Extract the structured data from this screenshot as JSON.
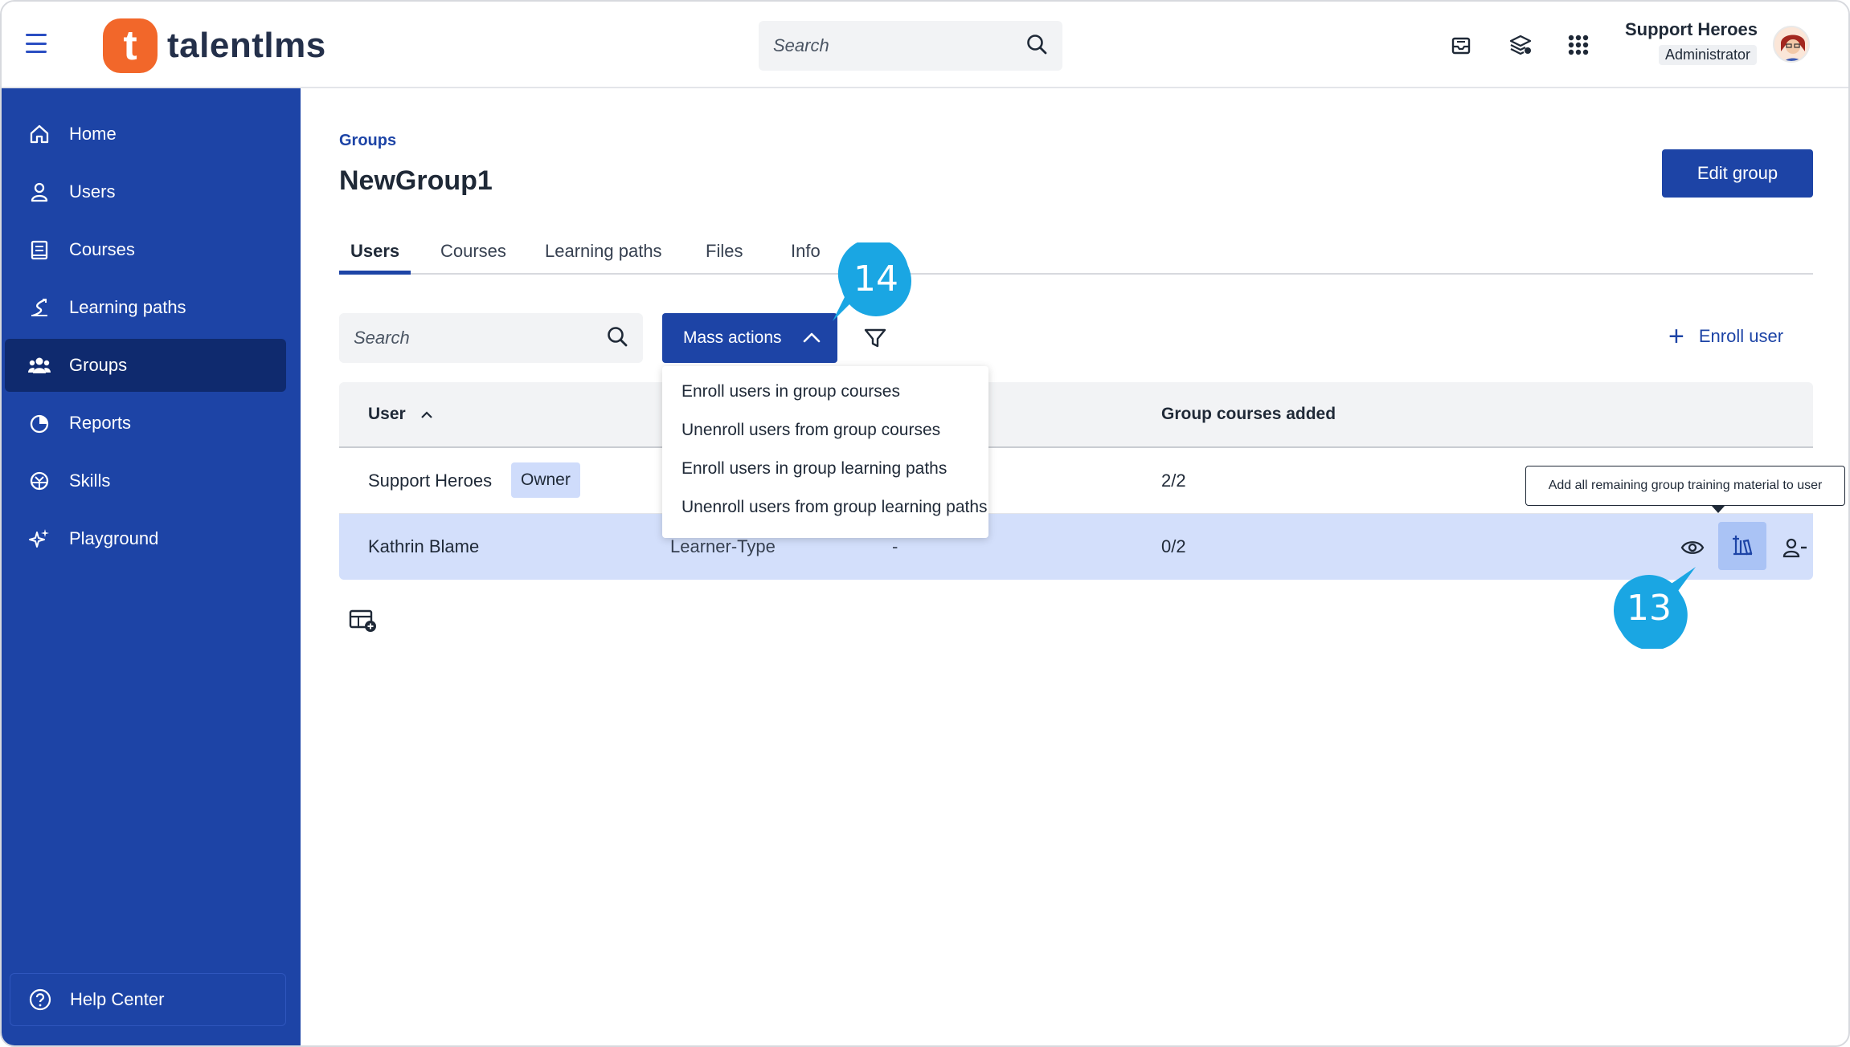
{
  "topbar": {
    "brand": "talentlms",
    "brand_mark": "t",
    "search_placeholder": "Search",
    "user_name": "Support Heroes",
    "user_role": "Administrator",
    "icons": [
      "inbox-icon",
      "catalog-icon",
      "apps-grid-icon"
    ]
  },
  "sidebar": {
    "items": [
      {
        "label": "Home",
        "icon": "home-icon"
      },
      {
        "label": "Users",
        "icon": "user-icon"
      },
      {
        "label": "Courses",
        "icon": "book-icon"
      },
      {
        "label": "Learning paths",
        "icon": "path-icon"
      },
      {
        "label": "Groups",
        "icon": "groups-icon",
        "active": true
      },
      {
        "label": "Reports",
        "icon": "pie-chart-icon"
      },
      {
        "label": "Skills",
        "icon": "skills-icon"
      },
      {
        "label": "Playground",
        "icon": "sparkle-icon"
      }
    ],
    "help_label": "Help Center"
  },
  "main": {
    "breadcrumb": "Groups",
    "title": "NewGroup1",
    "edit_button": "Edit group",
    "tabs": [
      {
        "label": "Users",
        "active": true
      },
      {
        "label": "Courses"
      },
      {
        "label": "Learning paths"
      },
      {
        "label": "Files"
      },
      {
        "label": "Info"
      }
    ],
    "search_placeholder": "Search",
    "mass_actions_label": "Mass actions",
    "enroll_user_label": "Enroll user",
    "table": {
      "columns": [
        "User",
        "Group courses added"
      ],
      "rows": [
        {
          "user": "Support Heroes",
          "badge": "Owner",
          "type": "",
          "extra": "",
          "courses": "2/2"
        },
        {
          "user": "Kathrin Blame",
          "badge": "",
          "type": "Learner-Type",
          "extra": "-",
          "courses": "0/2"
        }
      ]
    },
    "mass_actions_menu": [
      "Enroll users in group courses",
      "Unenroll users from group courses",
      "Enroll users in group learning paths",
      "Unenroll users from group learning paths"
    ],
    "tooltip": "Add all remaining group training material to user"
  },
  "callouts": [
    "14",
    "13"
  ],
  "colors": {
    "brand_blue": "#1d44a6",
    "sidebar_active": "#0f2a6e",
    "logo_orange": "#f2672a",
    "callout": "#1aa6e3",
    "row_highlight": "#d3dffb"
  }
}
